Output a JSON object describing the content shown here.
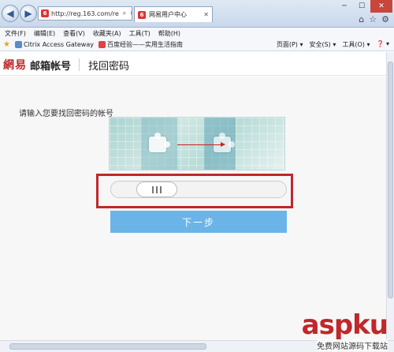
{
  "browser": {
    "address": "http://reg.163.com/re",
    "tab_title": "网易用户中心",
    "menu": [
      "文件(F)",
      "编辑(E)",
      "查看(V)",
      "收藏夹(A)",
      "工具(T)",
      "帮助(H)"
    ],
    "favorites": [
      "Citrix Access Gateway",
      "百度经验——实用生活指南"
    ],
    "toolbar_right": [
      "页面(P) ▾",
      "安全(S) ▾",
      "工具(O) ▾",
      "❓ ▾"
    ]
  },
  "site": {
    "logo": "網易",
    "logo_sub": "邮箱帐号",
    "heading": "找回密码"
  },
  "form": {
    "prompt": "请输入您要找回密码的帐号",
    "next_button": "下一步"
  },
  "watermark": {
    "text": "aspku",
    "sub": "免费网站源码下载站"
  }
}
